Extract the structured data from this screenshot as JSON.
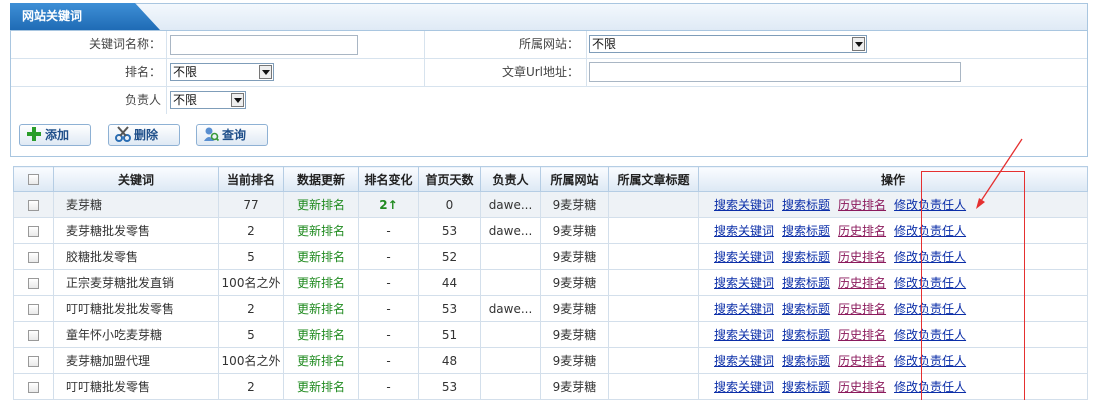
{
  "panel": {
    "title": "网站关键词"
  },
  "filters": {
    "keyword_label": "关键词名称：",
    "keyword_value": "",
    "site_label": "所属网站：",
    "site_value": "不限",
    "rank_label": "排名：",
    "rank_value": "不限",
    "url_label": "文章Url地址：",
    "url_value": "",
    "owner_label": "负责人",
    "owner_value": "不限"
  },
  "toolbar": {
    "add_label": "添加",
    "delete_label": "删除",
    "query_label": "查询"
  },
  "table": {
    "columns": [
      "",
      "关键词",
      "当前排名",
      "数据更新",
      "排名变化",
      "首页天数",
      "负责人",
      "所属网站",
      "所属文章标题",
      "操作"
    ],
    "op_labels": {
      "search_keyword": "搜索关键词",
      "search_title": "搜索标题",
      "history": "历史排名",
      "change_owner": "修改负责任人"
    },
    "rows": [
      {
        "keyword": "麦芽糖",
        "rank": "77",
        "update": "更新排名",
        "change": "2↑",
        "days": "0",
        "owner": "dawe...",
        "site": "9麦芽糖",
        "article": ""
      },
      {
        "keyword": "麦芽糖批发零售",
        "rank": "2",
        "update": "更新排名",
        "change": "-",
        "days": "53",
        "owner": "dawe...",
        "site": "9麦芽糖",
        "article": ""
      },
      {
        "keyword": "胶糖批发零售",
        "rank": "5",
        "update": "更新排名",
        "change": "-",
        "days": "52",
        "owner": "",
        "site": "9麦芽糖",
        "article": ""
      },
      {
        "keyword": "正宗麦芽糖批发直销",
        "rank": "100名之外",
        "update": "更新排名",
        "change": "-",
        "days": "44",
        "owner": "",
        "site": "9麦芽糖",
        "article": ""
      },
      {
        "keyword": "叮叮糖批发批发零售",
        "rank": "2",
        "update": "更新排名",
        "change": "-",
        "days": "53",
        "owner": "dawe...",
        "site": "9麦芽糖",
        "article": ""
      },
      {
        "keyword": "童年怀小吃麦芽糖",
        "rank": "5",
        "update": "更新排名",
        "change": "-",
        "days": "51",
        "owner": "",
        "site": "9麦芽糖",
        "article": ""
      },
      {
        "keyword": "麦芽糖加盟代理",
        "rank": "100名之外",
        "update": "更新排名",
        "change": "-",
        "days": "48",
        "owner": "",
        "site": "9麦芽糖",
        "article": ""
      },
      {
        "keyword": "叮叮糖批发零售",
        "rank": "2",
        "update": "更新排名",
        "change": "-",
        "days": "53",
        "owner": "",
        "site": "9麦芽糖",
        "article": ""
      }
    ]
  },
  "colors": {
    "accent": "#1f6bb5",
    "link": "#0b2ea8",
    "update_green": "#1f8a1f",
    "highlight_red": "#e53030"
  }
}
